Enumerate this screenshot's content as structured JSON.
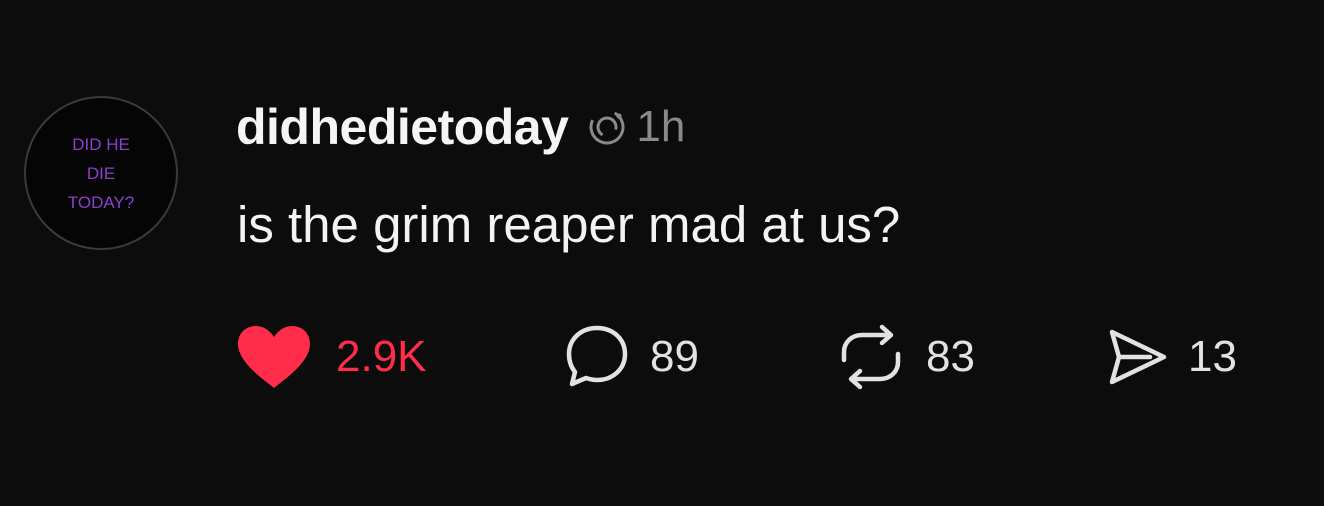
{
  "avatar": {
    "text": "DID HE\nDIE\nTODAY?"
  },
  "post": {
    "username": "didhedietoday",
    "timestamp": "1h",
    "text": "is the grim reaper mad at us?"
  },
  "actions": {
    "likes": "2.9K",
    "replies": "89",
    "reposts": "83",
    "shares": "13"
  },
  "colors": {
    "background": "#0c0c0c",
    "like": "#ff2d4a",
    "avatar_text": "#8e3fd0",
    "muted": "#8a8a8a"
  },
  "icons": {
    "status": "threads-activity-icon",
    "like": "heart-icon",
    "reply": "speech-bubble-icon",
    "repost": "repost-arrows-icon",
    "share": "paper-plane-icon"
  }
}
